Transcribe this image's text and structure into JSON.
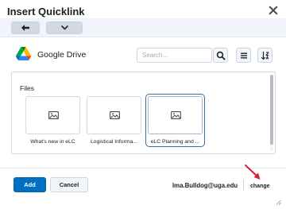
{
  "dialog": {
    "title": "Insert Quicklink"
  },
  "toolbar": {
    "back_icon": "arrow-left-icon",
    "menu_icon": "chevron-down-icon"
  },
  "source": {
    "name": "Google Drive",
    "logo_icon": "google-drive-icon"
  },
  "search": {
    "placeholder": "Search..."
  },
  "files": {
    "heading": "Files",
    "items": [
      {
        "name": "What's new in eLC",
        "selected": false
      },
      {
        "name": "Logistical Informa...",
        "selected": false
      },
      {
        "name": "eLC Planning and ...",
        "selected": true
      }
    ]
  },
  "footer": {
    "add_label": "Add",
    "cancel_label": "Cancel",
    "account_email": "lma.Bulldog@uga.edu",
    "change_label": "change"
  },
  "colors": {
    "primary": "#006fbf",
    "selection_border": "#3b6ea5",
    "annotation_arrow": "#d4203a"
  }
}
